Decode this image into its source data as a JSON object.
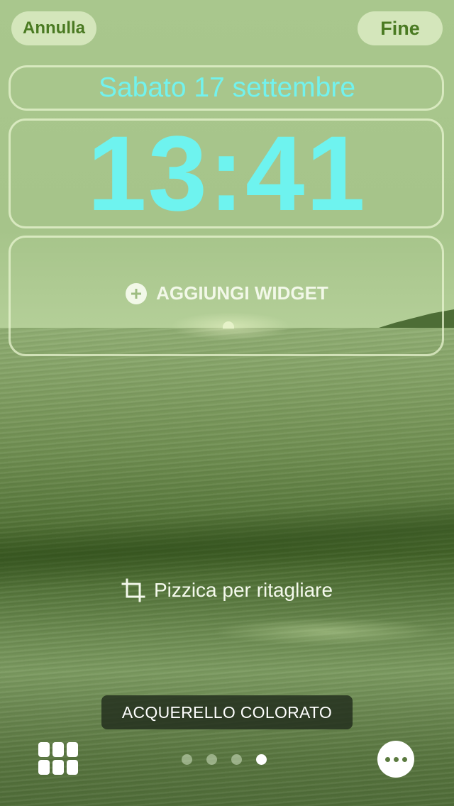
{
  "header": {
    "cancel_label": "Annulla",
    "done_label": "Fine"
  },
  "lock_screen": {
    "date": "Sabato 17 settembre",
    "time": "13:41",
    "add_widget_label": "AGGIUNGI WIDGET"
  },
  "hint": {
    "crop_label": "Pizzica per ritagliare"
  },
  "filter": {
    "name": "ACQUERELLO COLORATO"
  },
  "pager": {
    "total_pages": 4,
    "current_page": 4
  },
  "colors": {
    "clock_accent": "#6ef3ef",
    "button_text": "#4a7a22",
    "wallpaper_tint": "#a7c58b"
  },
  "icons": {
    "widget_add": "plus-circle-icon",
    "crop": "crop-icon",
    "gallery": "grid-icon",
    "more": "ellipsis-icon"
  }
}
